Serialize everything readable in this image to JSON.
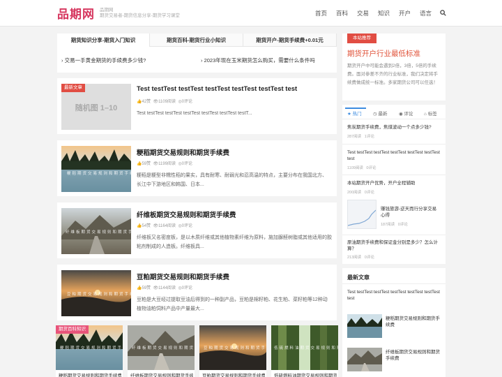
{
  "header": {
    "logo": "品期网",
    "tagline_1": "品期网",
    "tagline_2": "期货交易者-期货信息分享-期货学习课堂",
    "nav": [
      "首页",
      "百科",
      "交易",
      "知识",
      "开户",
      "语言"
    ],
    "search_icon": "search-icon"
  },
  "tabs": {
    "items": [
      "期货知识分享-期货入门知识",
      "期货百科-期货行业小知识",
      "期货开户-期货手续费+0.01元"
    ],
    "links": [
      "交易一手黄金期货的手续费多少钱?",
      "2023年现在玉米期货怎么购买，需要什么条件吗"
    ]
  },
  "posts": [
    {
      "badge": "最新文章",
      "thumb_text": "随机图 1–10",
      "title": "Test testTest testTest testTest testTest testTest test",
      "likes": "42赞",
      "views": "1109阅读",
      "comments": "0评论",
      "excerpt": "Test testTest testTest testTest testTest testTest testT..."
    },
    {
      "title": "粳稻期货交易规则和期货手续费",
      "likes": "59赞",
      "views": "1199阅读",
      "comments": "0评论",
      "excerpt": "粳稻是粳型非糯性稻的果实，具有耐寒、耐弱光和忍高温的特点，主要分布在我国北方、 长江中下游地区和韩国、日本...",
      "img_text": "粳稻期货交易规则和期货手续费"
    },
    {
      "title": "纤维板期货交易规则和期货手续费",
      "likes": "54赞",
      "views": "1164阅读",
      "comments": "0评论",
      "excerpt": "纤维板又名密度板，是以木质纤维或其他植物素纤维为原料，施加脲醛树脂或其他适用的胶粘剂制成的人造板。纤维板具...",
      "img_text": "纤维板期货交易规则和期货手续费"
    },
    {
      "title": "豆粕期货交易规则和期货手续费",
      "likes": "59赞",
      "views": "1144阅读",
      "comments": "0评论",
      "excerpt": "豆粕是大豆经过提取豆油后得到的一种副产品，豆粕是棉籽粕、花生粕、菜籽粕等12种动植物油粕饲料产品中产量最大...",
      "img_text": "豆粕期货交易规则和期货手续费"
    }
  ],
  "grid": {
    "badge": "期货百科知识",
    "items": [
      {
        "title": "粳稻期货交易规则和期货手续费",
        "img_text": "粳稻期货交易规则和期货手续费"
      },
      {
        "title": "纤维板期货交易规则和期货手续费",
        "img_text": "纤维板期货交易规则和期货手续费"
      },
      {
        "title": "豆粕期货交易规则和期货手续费",
        "img_text": "豆粕期货交易规则和期货手续费"
      },
      {
        "title": "低硫燃料油期货交易规则和期货手续费",
        "img_text": "低硫燃料油期货交易规则和期货手续费"
      }
    ]
  },
  "sidebar": {
    "recommend_badge": "本站推荐",
    "recommend_title": "期货开户行业最低标准",
    "recommend_text": "期货开户中可能会遇到2倍，3倍，5倍的手续费。面对参差不齐的行业标准，我们决定将手续费做成统一标准。多家期货公司可以任选！",
    "tabs": [
      "热门",
      "最新",
      "评论",
      "标签"
    ],
    "hot": [
      {
        "title": "焦炭期货手续费，焦煤波动一个点多少钱?",
        "views": "287阅读",
        "comments": "1评论"
      },
      {
        "title": "Test testTest testTest testTest testTest testTest test",
        "views": "1109阅读",
        "comments": "0评论"
      },
      {
        "title": "本站期货开户优势，开户全程辅助",
        "views": "200阅读",
        "comments": "0评论"
      },
      {
        "title": "赚钱旅游-逆天而行分享交易心得",
        "views": "187阅读",
        "comments": "0评论"
      },
      {
        "title": "原油期货手续费和保证金分别是多少？怎么计算？",
        "views": "213阅读",
        "comments": "0评论"
      }
    ],
    "latest_title": "最新文章",
    "latest": [
      {
        "title": "Test testTest testTest testTest testTest testTest test"
      },
      {
        "title": "粳稻期货交易规则和期货手续费"
      },
      {
        "title": "纤维板期货交易规则和期货手续费"
      }
    ]
  },
  "colors": {
    "brand": "#d6365e",
    "accent_red": "#e14d43",
    "recommend_title": "#e0533a",
    "grid_badge": "#e8547a"
  }
}
